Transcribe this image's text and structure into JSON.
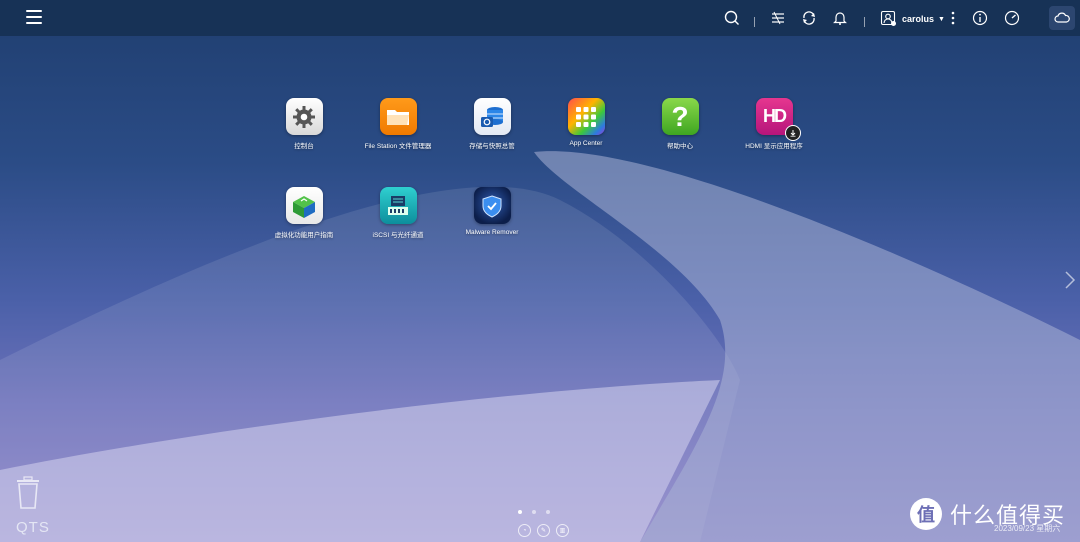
{
  "topbar": {
    "username": "carolus",
    "icons": [
      "menu-icon",
      "search-icon",
      "tasks-icon",
      "sync-icon",
      "notification-icon",
      "user-icon",
      "more-icon",
      "info-icon",
      "dashboard-icon",
      "cloud-icon"
    ]
  },
  "apps": [
    {
      "label": "控制台",
      "icon": "gear-icon"
    },
    {
      "label": "File Station 文件管理器",
      "icon": "folder-icon"
    },
    {
      "label": "存储与快照总管",
      "icon": "storage-icon"
    },
    {
      "label": "App Center",
      "icon": "grid-icon"
    },
    {
      "label": "帮助中心",
      "icon": "question-icon"
    },
    {
      "label": "HDMI 显示应用程序",
      "icon": "hd-icon"
    },
    {
      "label": "虚拟化功能用户指南",
      "icon": "cube-icon"
    },
    {
      "label": "iSCSI 与光纤通道",
      "icon": "iscsi-icon"
    },
    {
      "label": "Malware Remover",
      "icon": "shield-icon"
    }
  ],
  "bottom": {
    "brand": "QTS",
    "datetime": "2023/09/23 星期六",
    "watermark_char": "值",
    "watermark_text": "什么值得买"
  },
  "colors": {
    "topbar": "#173256",
    "accent": "#fff"
  }
}
